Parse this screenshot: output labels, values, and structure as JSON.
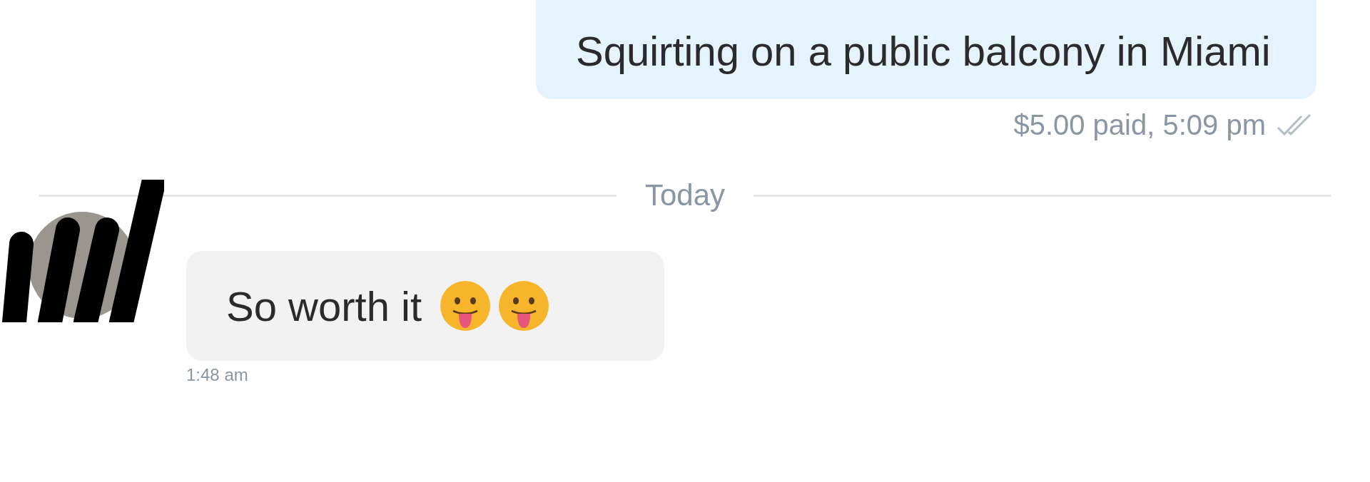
{
  "messages": [
    {
      "kind": "outgoing",
      "text": "Squirting on a public balcony in Miami",
      "meta": "$5.00 paid, 5:09 pm",
      "read": true
    },
    {
      "kind": "divider",
      "text": "Today"
    },
    {
      "kind": "incoming",
      "text": "So worth it",
      "time": "1:48 am"
    }
  ]
}
